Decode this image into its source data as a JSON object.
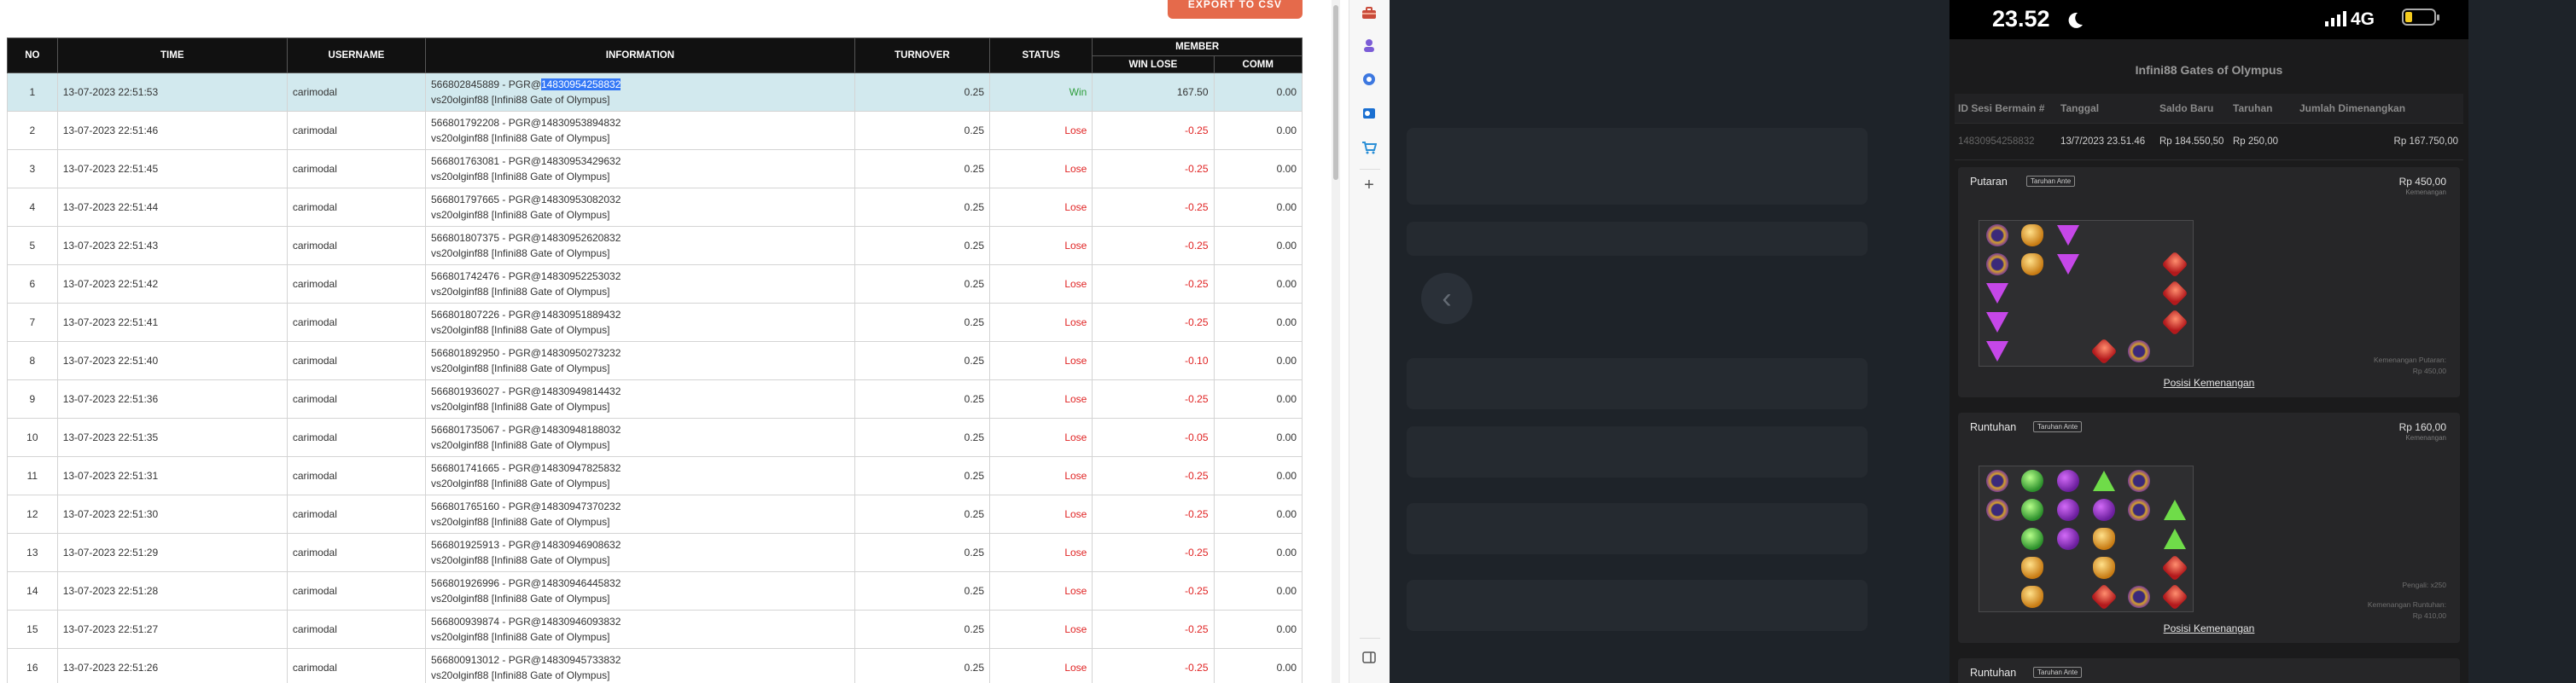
{
  "export_button": "EXPORT TO CSV",
  "table": {
    "headers": {
      "no": "NO",
      "time": "TIME",
      "username": "USERNAME",
      "information": "INFORMATION",
      "turnover": "TURNOVER",
      "status": "STATUS",
      "member": "MEMBER",
      "win_lose": "WIN LOSE",
      "comm": "COMM"
    },
    "rows": [
      {
        "no": "1",
        "time": "13-07-2023 22:51:53",
        "username": "carimodal",
        "info_prefix": "566802845889 - PGR@",
        "info_highlight": "14830954258832",
        "info_line2": "vs20olginf88 [Infini88 Gate of Olympus]",
        "turnover": "0.25",
        "status": "Win",
        "win_lose": "167.50",
        "comm": "0.00"
      },
      {
        "no": "2",
        "time": "13-07-2023 22:51:46",
        "username": "carimodal",
        "info_prefix": "566801792208 - PGR@14830953894832",
        "info_highlight": "",
        "info_line2": "vs20olginf88 [Infini88 Gate of Olympus]",
        "turnover": "0.25",
        "status": "Lose",
        "win_lose": "-0.25",
        "comm": "0.00"
      },
      {
        "no": "3",
        "time": "13-07-2023 22:51:45",
        "username": "carimodal",
        "info_prefix": "566801763081 - PGR@14830953429632",
        "info_highlight": "",
        "info_line2": "vs20olginf88 [Infini88 Gate of Olympus]",
        "turnover": "0.25",
        "status": "Lose",
        "win_lose": "-0.25",
        "comm": "0.00"
      },
      {
        "no": "4",
        "time": "13-07-2023 22:51:44",
        "username": "carimodal",
        "info_prefix": "566801797665 - PGR@14830953082032",
        "info_highlight": "",
        "info_line2": "vs20olginf88 [Infini88 Gate of Olympus]",
        "turnover": "0.25",
        "status": "Lose",
        "win_lose": "-0.25",
        "comm": "0.00"
      },
      {
        "no": "5",
        "time": "13-07-2023 22:51:43",
        "username": "carimodal",
        "info_prefix": "566801807375 - PGR@14830952620832",
        "info_highlight": "",
        "info_line2": "vs20olginf88 [Infini88 Gate of Olympus]",
        "turnover": "0.25",
        "status": "Lose",
        "win_lose": "-0.25",
        "comm": "0.00"
      },
      {
        "no": "6",
        "time": "13-07-2023 22:51:42",
        "username": "carimodal",
        "info_prefix": "566801742476 - PGR@14830952253032",
        "info_highlight": "",
        "info_line2": "vs20olginf88 [Infini88 Gate of Olympus]",
        "turnover": "0.25",
        "status": "Lose",
        "win_lose": "-0.25",
        "comm": "0.00"
      },
      {
        "no": "7",
        "time": "13-07-2023 22:51:41",
        "username": "carimodal",
        "info_prefix": "566801807226 - PGR@14830951889432",
        "info_highlight": "",
        "info_line2": "vs20olginf88 [Infini88 Gate of Olympus]",
        "turnover": "0.25",
        "status": "Lose",
        "win_lose": "-0.25",
        "comm": "0.00"
      },
      {
        "no": "8",
        "time": "13-07-2023 22:51:40",
        "username": "carimodal",
        "info_prefix": "566801892950 - PGR@14830950273232",
        "info_highlight": "",
        "info_line2": "vs20olginf88 [Infini88 Gate of Olympus]",
        "turnover": "0.25",
        "status": "Lose",
        "win_lose": "-0.10",
        "comm": "0.00"
      },
      {
        "no": "9",
        "time": "13-07-2023 22:51:36",
        "username": "carimodal",
        "info_prefix": "566801936027 - PGR@14830949814432",
        "info_highlight": "",
        "info_line2": "vs20olginf88 [Infini88 Gate of Olympus]",
        "turnover": "0.25",
        "status": "Lose",
        "win_lose": "-0.25",
        "comm": "0.00"
      },
      {
        "no": "10",
        "time": "13-07-2023 22:51:35",
        "username": "carimodal",
        "info_prefix": "566801735067 - PGR@14830948188032",
        "info_highlight": "",
        "info_line2": "vs20olginf88 [Infini88 Gate of Olympus]",
        "turnover": "0.25",
        "status": "Lose",
        "win_lose": "-0.05",
        "comm": "0.00"
      },
      {
        "no": "11",
        "time": "13-07-2023 22:51:31",
        "username": "carimodal",
        "info_prefix": "566801741665 - PGR@14830947825832",
        "info_highlight": "",
        "info_line2": "vs20olginf88 [Infini88 Gate of Olympus]",
        "turnover": "0.25",
        "status": "Lose",
        "win_lose": "-0.25",
        "comm": "0.00"
      },
      {
        "no": "12",
        "time": "13-07-2023 22:51:30",
        "username": "carimodal",
        "info_prefix": "566801765160 - PGR@14830947370232",
        "info_highlight": "",
        "info_line2": "vs20olginf88 [Infini88 Gate of Olympus]",
        "turnover": "0.25",
        "status": "Lose",
        "win_lose": "-0.25",
        "comm": "0.00"
      },
      {
        "no": "13",
        "time": "13-07-2023 22:51:29",
        "username": "carimodal",
        "info_prefix": "566801925913 - PGR@14830946908632",
        "info_highlight": "",
        "info_line2": "vs20olginf88 [Infini88 Gate of Olympus]",
        "turnover": "0.25",
        "status": "Lose",
        "win_lose": "-0.25",
        "comm": "0.00"
      },
      {
        "no": "14",
        "time": "13-07-2023 22:51:28",
        "username": "carimodal",
        "info_prefix": "566801926996 - PGR@14830946445832",
        "info_highlight": "",
        "info_line2": "vs20olginf88 [Infini88 Gate of Olympus]",
        "turnover": "0.25",
        "status": "Lose",
        "win_lose": "-0.25",
        "comm": "0.00"
      },
      {
        "no": "15",
        "time": "13-07-2023 22:51:27",
        "username": "carimodal",
        "info_prefix": "566800939874 - PGR@14830946093832",
        "info_highlight": "",
        "info_line2": "vs20olginf88 [Infini88 Gate of Olympus]",
        "turnover": "0.25",
        "status": "Lose",
        "win_lose": "-0.25",
        "comm": "0.00"
      },
      {
        "no": "16",
        "time": "13-07-2023 22:51:26",
        "username": "carimodal",
        "info_prefix": "566800913012 - PGR@14830945733832",
        "info_highlight": "",
        "info_line2": "vs20olginf88 [Infini88 Gate of Olympus]",
        "turnover": "0.25",
        "status": "Lose",
        "win_lose": "-0.25",
        "comm": "0.00"
      }
    ]
  },
  "status_colors": {
    "win": "#2e9e3b",
    "lose": "#e02323"
  },
  "edge_bar": {
    "icons": [
      "toolbox-icon",
      "person-icon",
      "copilot-icon",
      "outlook-icon",
      "shopping-icon",
      "plus-icon",
      "sidebar-toggle-icon"
    ]
  },
  "phone": {
    "status_time": "23.52",
    "network": "4G",
    "title": "Infini88 Gates of Olympus",
    "columns": [
      "ID Sesi Bermain #",
      "Tanggal",
      "Saldo Baru",
      "Taruhan",
      "Jumlah Dimenangkan"
    ],
    "row": {
      "id": "14830954258832",
      "date": "13/7/2023 23.51.46",
      "balance": "Rp 184.550,50",
      "bet": "Rp 250,00",
      "won": "Rp 167.750,00"
    },
    "card1": {
      "title": "Putaran",
      "badge": "Taruhan Ante",
      "amount": "Rp 450,00",
      "amount_sub": "Kemenangan",
      "note1": "Kemenangan Putaran:",
      "note2": "Rp 450,00",
      "link": "Posisi Kemenangan"
    },
    "card2": {
      "title": "Runtuhan",
      "badge": "Taruhan Ante",
      "amount": "Rp 160,00",
      "amount_sub": "Kemenangan",
      "note0": "Pengali: x250",
      "note1": "Kemenangan Runtuhan:",
      "note2": "Rp 410,00",
      "link": "Posisi Kemenangan"
    },
    "card3": {
      "title": "Runtuhan",
      "badge": "Taruhan Ante"
    }
  }
}
